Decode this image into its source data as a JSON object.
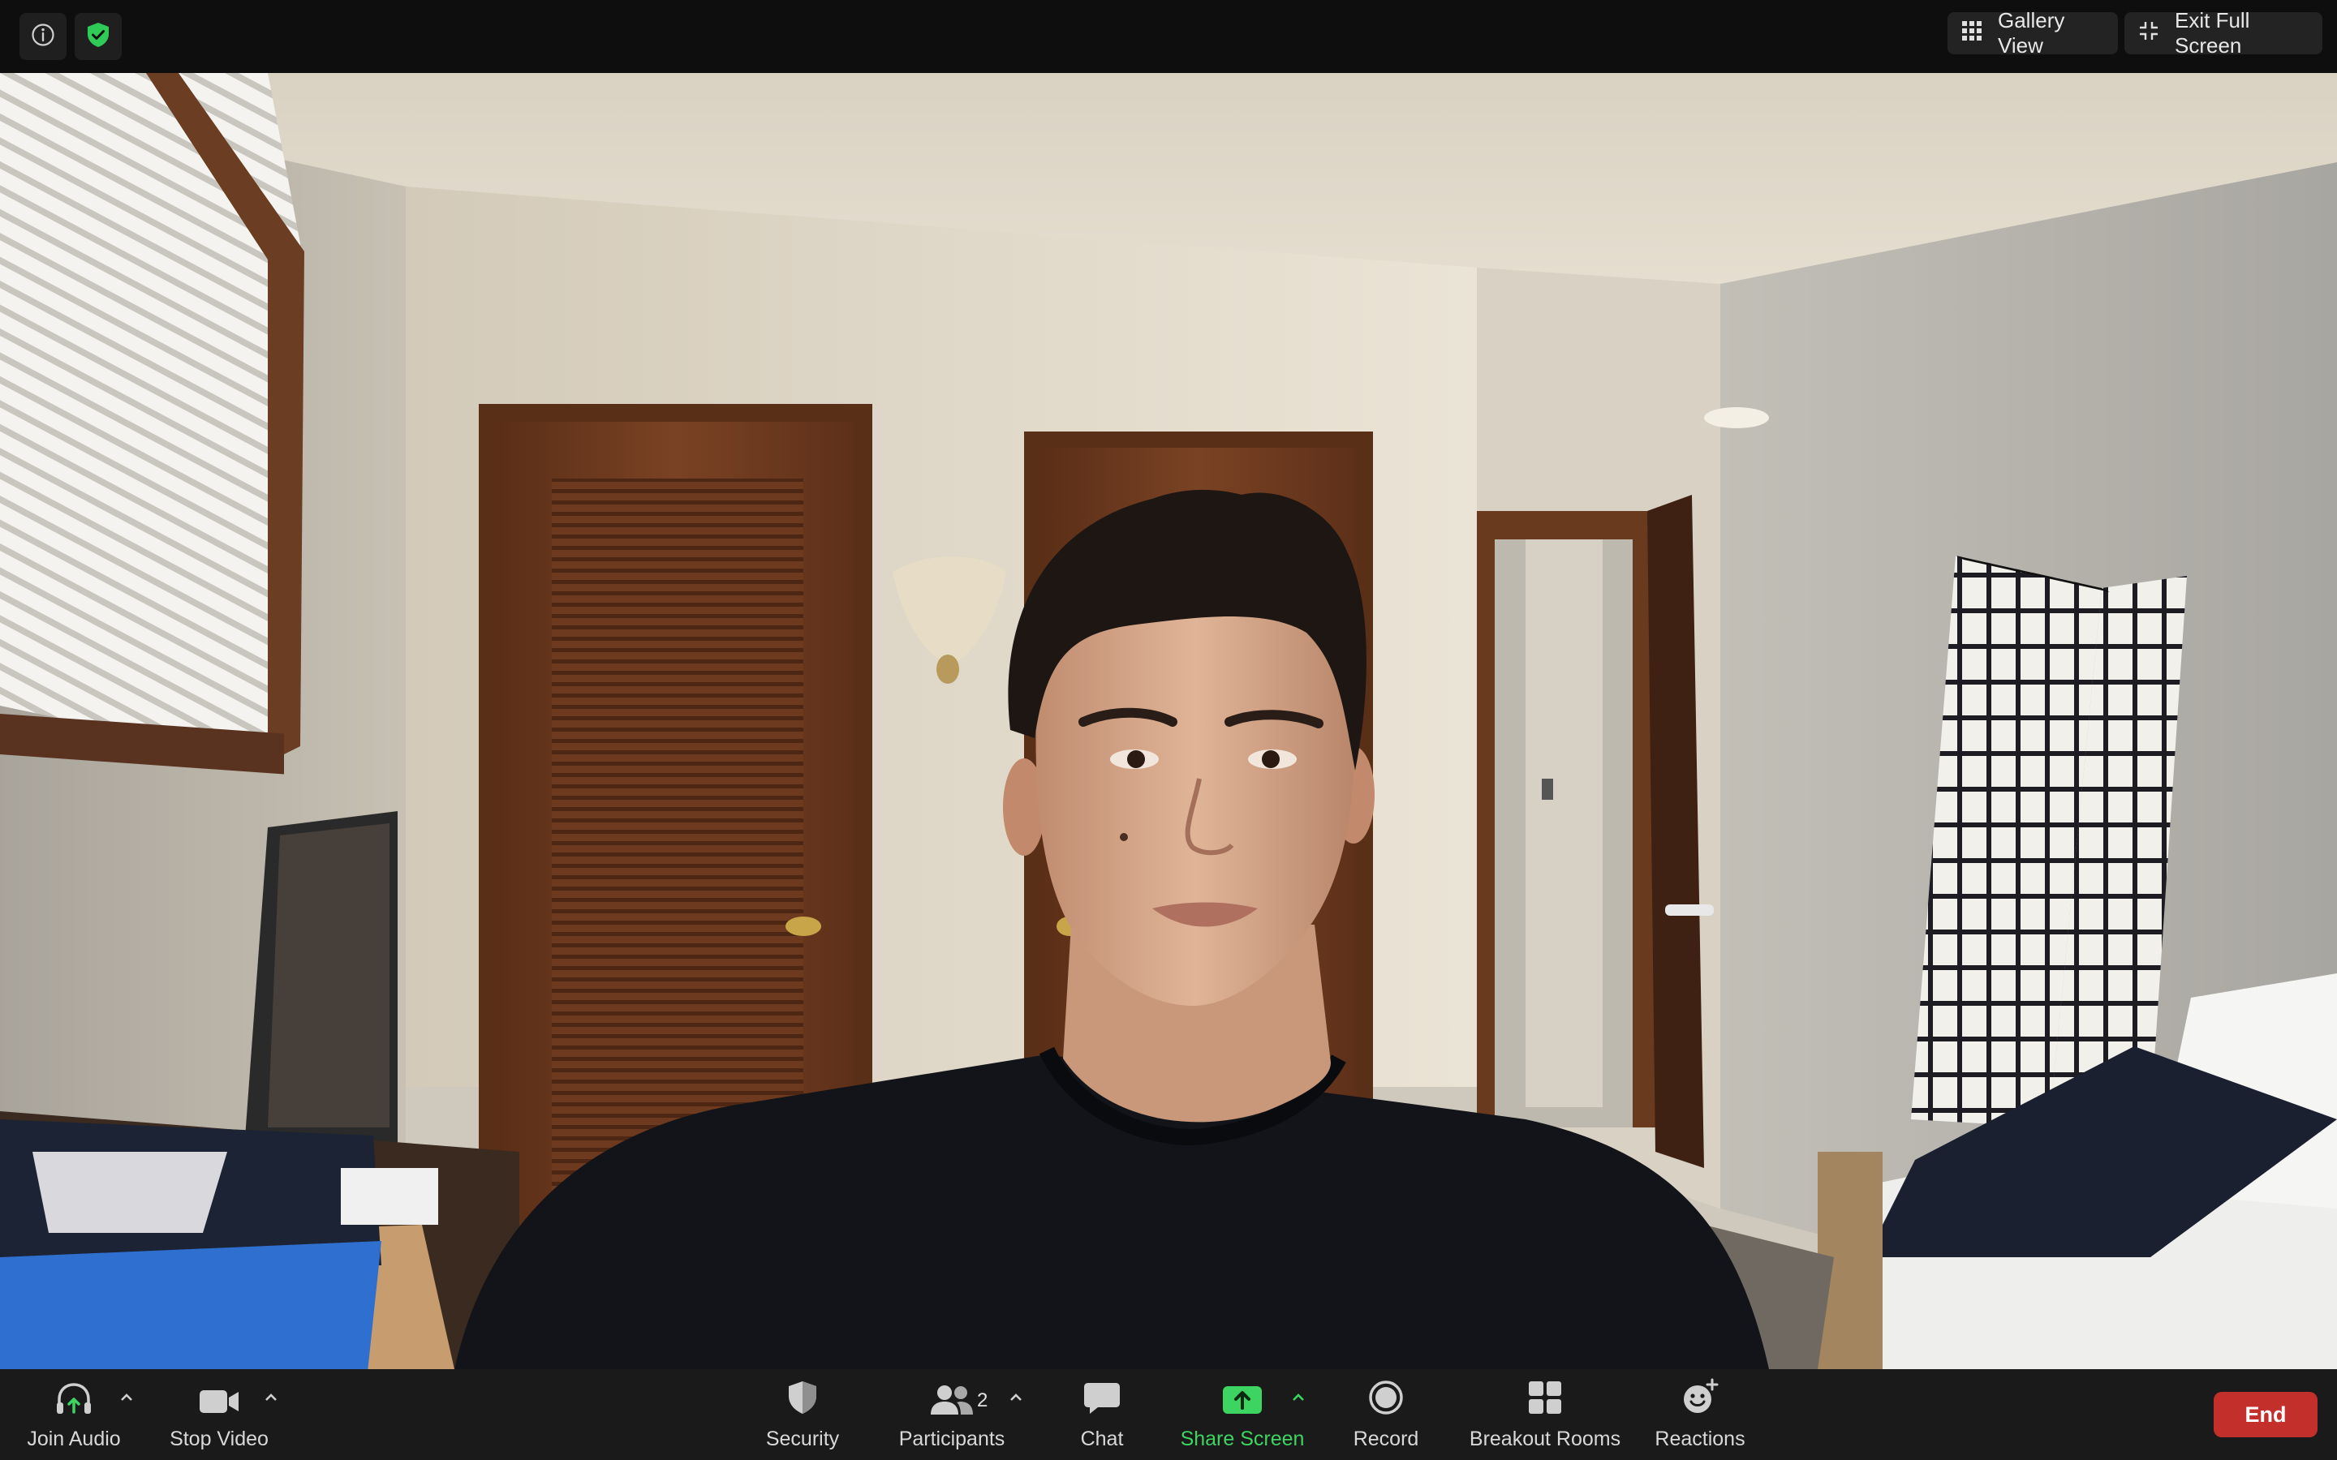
{
  "window": {
    "mode": "full-screen video meeting"
  },
  "topbar": {
    "info_icon": "info-icon",
    "security_status_icon": "shield-check-icon",
    "gallery_view_label": "Gallery View",
    "exit_full_screen_label": "Exit Full Screen"
  },
  "toolbar": {
    "join_audio_label": "Join Audio",
    "stop_video_label": "Stop Video",
    "security_label": "Security",
    "participants_label": "Participants",
    "participants_count": "2",
    "chat_label": "Chat",
    "share_screen_label": "Share Screen",
    "record_label": "Record",
    "breakout_rooms_label": "Breakout Rooms",
    "reactions_label": "Reactions",
    "end_label": "End"
  },
  "colors": {
    "share_screen_green": "#3ed461",
    "end_red": "#c3302c",
    "security_shield_green": "#2ecc57",
    "toolbar_bg": "#1a1a1a"
  }
}
